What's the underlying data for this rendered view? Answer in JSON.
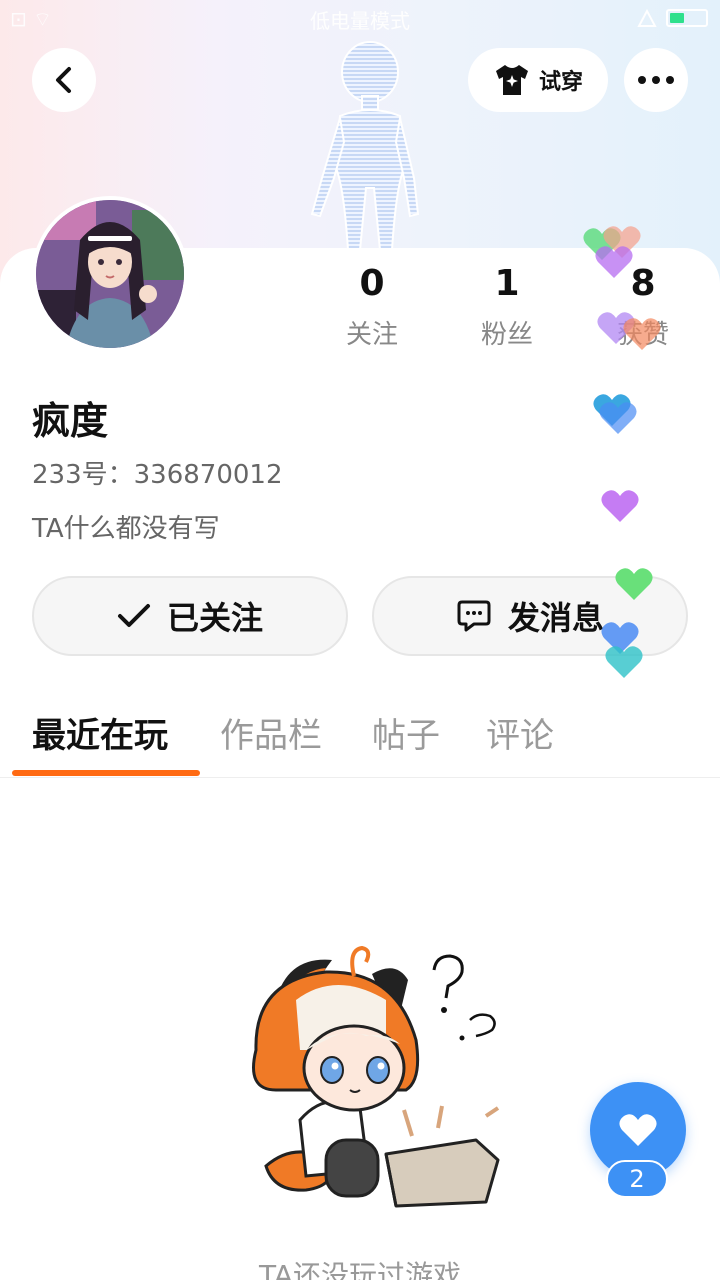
{
  "status_bar": {
    "left": "⊡ ⌔",
    "center": "低电量模式"
  },
  "header": {
    "tryon_label": "试穿"
  },
  "profile": {
    "stats": [
      {
        "value": "0",
        "label": "关注"
      },
      {
        "value": "1",
        "label": "粉丝"
      },
      {
        "value": "8",
        "label": "获赞"
      }
    ],
    "nickname": "疯度",
    "uid_text": "233号：336870012",
    "bio": "TA什么都没有写"
  },
  "actions": {
    "followed_label": "已关注",
    "message_label": "发消息"
  },
  "tabs": [
    {
      "label": "最近在玩",
      "active": true
    },
    {
      "label": "作品栏",
      "active": false
    },
    {
      "label": "帖子",
      "active": false
    },
    {
      "label": "评论",
      "active": false
    }
  ],
  "empty_state": {
    "text": "TA还没玩过游戏"
  },
  "float_like": {
    "count": "2"
  },
  "colors": {
    "accent_orange": "#ff6a13",
    "like_blue": "#3d91f5"
  },
  "icons": [
    "back-icon",
    "tshirt-icon",
    "more-icon",
    "check-icon",
    "chat-icon",
    "heart-icon"
  ]
}
